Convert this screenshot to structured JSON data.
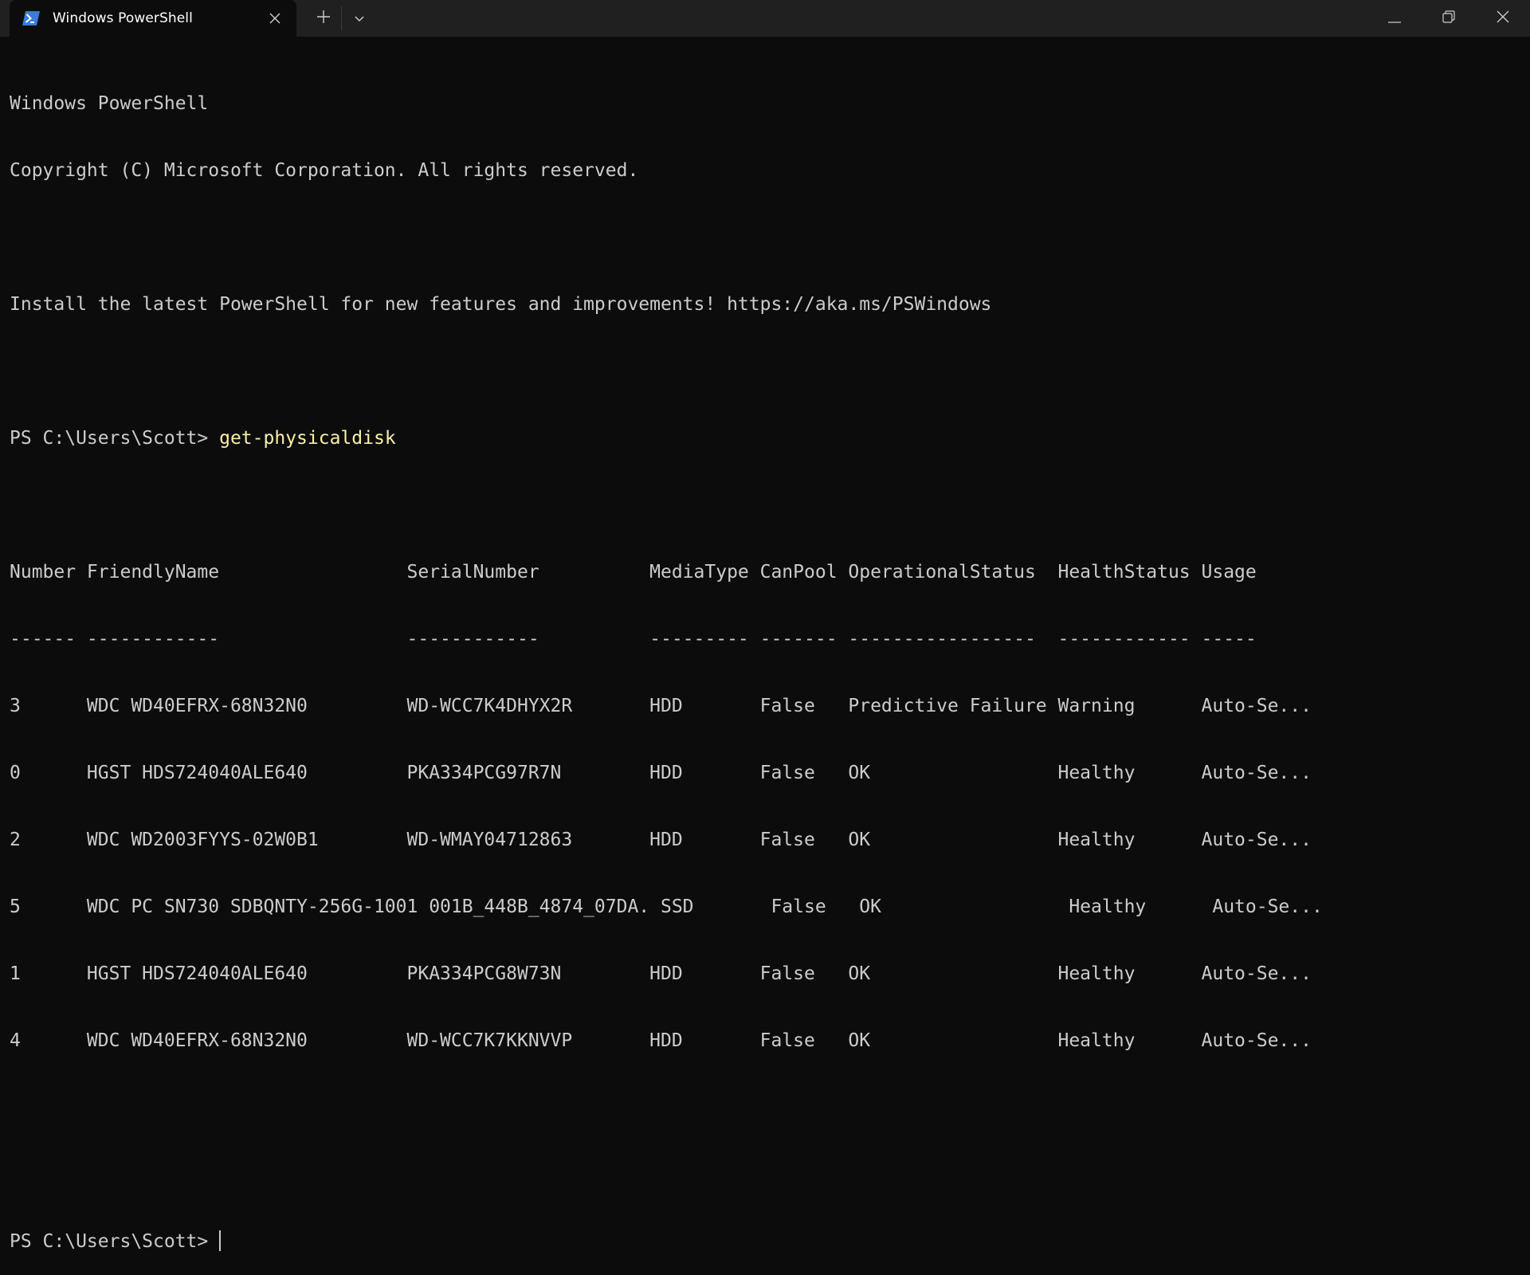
{
  "window": {
    "tab_title": "Windows PowerShell",
    "icons": {
      "tab": "powershell-icon",
      "tab_close": "close-icon",
      "new_tab": "plus-icon",
      "dropdown": "chevron-down-icon",
      "minimize": "minimize-icon",
      "maximize": "restore-icon",
      "close": "close-icon"
    }
  },
  "colors": {
    "background": "#0c0c0c",
    "titlebar": "#202020",
    "text": "#cccccc",
    "command": "#f9f1a5"
  },
  "terminal": {
    "banner_1": "Windows PowerShell",
    "banner_2": "Copyright (C) Microsoft Corporation. All rights reserved.",
    "banner_3": "Install the latest PowerShell for new features and improvements! https://aka.ms/PSWindows",
    "prompt": "PS C:\\Users\\Scott> ",
    "command": "get-physicaldisk",
    "table_header": "Number FriendlyName                 SerialNumber          MediaType CanPool OperationalStatus  HealthStatus Usage",
    "table_underline": "------ ------------                 ------------          --------- ------- -----------------  ------------ -----",
    "rows": [
      "3      WDC WD40EFRX-68N32N0         WD-WCC7K4DHYX2R       HDD       False   Predictive Failure Warning      Auto-Se...",
      "0      HGST HDS724040ALE640         PKA334PCG97R7N        HDD       False   OK                 Healthy      Auto-Se...",
      "2      WDC WD2003FYYS-02W0B1        WD-WMAY04712863       HDD       False   OK                 Healthy      Auto-Se...",
      "5      WDC PC SN730 SDBQNTY-256G-1001 001B_448B_4874_07DA. SSD       False   OK                 Healthy      Auto-Se...",
      "1      HGST HDS724040ALE640         PKA334PCG8W73N        HDD       False   OK                 Healthy      Auto-Se...",
      "4      WDC WD40EFRX-68N32N0         WD-WCC7K7KKNVVP       HDD       False   OK                 Healthy      Auto-Se..."
    ],
    "final_prompt": "PS C:\\Users\\Scott> "
  }
}
